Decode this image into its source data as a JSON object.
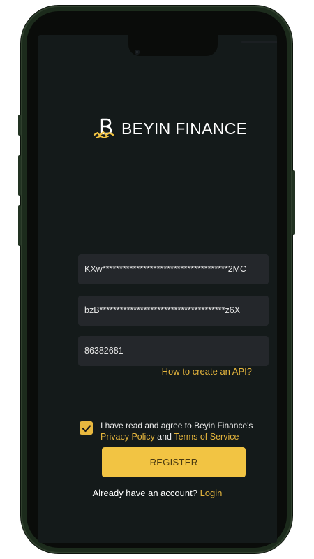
{
  "app": {
    "brand_name": "BEYIN FINANCE",
    "brand_color": "#f2c443",
    "accent_link_color": "#e4b53d",
    "background_color": "#141a1a",
    "field_color": "#24272b"
  },
  "form": {
    "api_key_value": "KXw*************************************2MC",
    "secret_key_value": "bzB*************************************z6X",
    "id_value": "86382681",
    "how_to_link": "How to create an API?"
  },
  "agreement": {
    "checked": true,
    "text_prefix": "I have read and agree to Beyin Finance's",
    "privacy_link": "Privacy Policy",
    "and_text": "and",
    "terms_link": "Terms of Service"
  },
  "actions": {
    "register_label": "REGISTER",
    "login_prompt": "Already have an account?",
    "login_link": "Login"
  },
  "icons": {
    "logo": "beyin-logo-icon",
    "checkbox": "checkmark-icon"
  }
}
